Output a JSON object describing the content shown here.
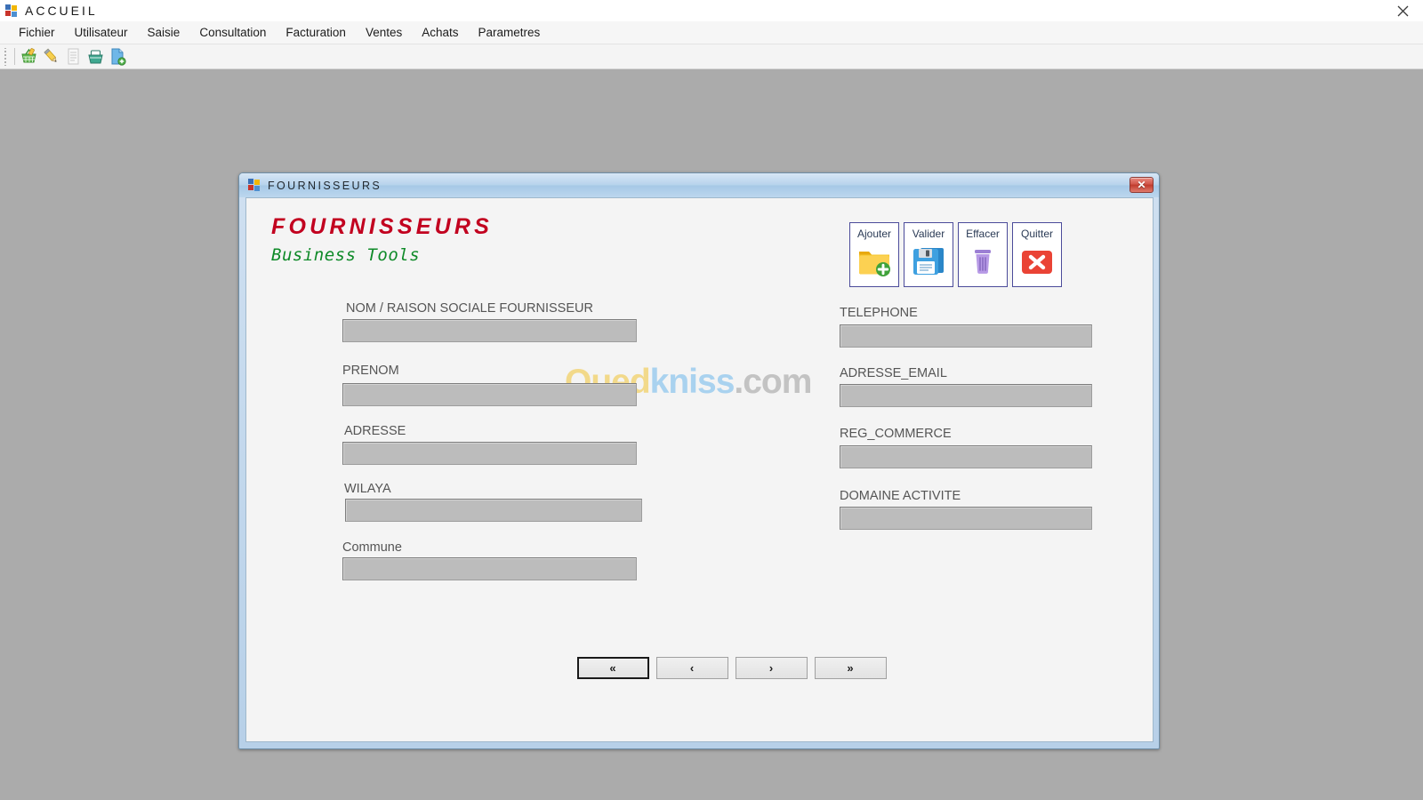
{
  "main_window": {
    "title": "ACCUEIL",
    "icon": "app-squares-icon",
    "close_label": "×"
  },
  "menubar": {
    "items": [
      {
        "label": "Fichier",
        "name": "fichier"
      },
      {
        "label": "Utilisateur",
        "name": "utilisateur"
      },
      {
        "label": "Saisie",
        "name": "saisie"
      },
      {
        "label": "Consultation",
        "name": "consultation"
      },
      {
        "label": "Facturation",
        "name": "facturation"
      },
      {
        "label": "Ventes",
        "name": "ventes"
      },
      {
        "label": "Achats",
        "name": "achats"
      },
      {
        "label": "Parametres",
        "name": "parametres"
      }
    ]
  },
  "toolbar": {
    "buttons": [
      {
        "icon": "basket-edit-icon",
        "enabled": true
      },
      {
        "icon": "pencil-icon",
        "enabled": true
      },
      {
        "icon": "document-list-icon",
        "enabled": false
      },
      {
        "icon": "basket-icon",
        "enabled": true
      },
      {
        "icon": "document-add-icon",
        "enabled": true
      }
    ]
  },
  "dialog": {
    "title": "FOURNISSEURS",
    "icon": "app-squares-icon",
    "close_label": "✕",
    "brand": {
      "title": "FOURNISSEURS",
      "subtitle": "Business Tools",
      "title_color": "#c2001f",
      "subtitle_color": "#0e8a28"
    },
    "watermark": {
      "part1": "Oued",
      "part2": "kniss",
      "part3": ".com",
      "color1": "#f2d98a",
      "color2": "#a9d2ef",
      "color3": "#c3c3c3"
    },
    "actions": [
      {
        "label": "Ajouter",
        "icon": "folder-add-icon",
        "name": "ajouter"
      },
      {
        "label": "Valider",
        "icon": "floppy-save-icon",
        "name": "valider"
      },
      {
        "label": "Effacer",
        "icon": "trash-icon",
        "name": "effacer"
      },
      {
        "label": "Quitter",
        "icon": "red-close-icon",
        "name": "quitter"
      }
    ],
    "fields_left": [
      {
        "label": "NOM / RAISON SOCIALE FOURNISSEUR",
        "value": "",
        "name": "nom-raison-sociale-fournisseur"
      },
      {
        "label": "PRENOM",
        "value": "",
        "name": "prenom"
      },
      {
        "label": "ADRESSE",
        "value": "",
        "name": "adresse"
      },
      {
        "label": "WILAYA",
        "value": "",
        "name": "wilaya"
      },
      {
        "label": "Commune",
        "value": "",
        "name": "commune"
      }
    ],
    "fields_right": [
      {
        "label": "TELEPHONE",
        "value": "",
        "name": "telephone"
      },
      {
        "label": "ADRESSE_EMAIL",
        "value": "",
        "name": "adresse-email"
      },
      {
        "label": "REG_COMMERCE",
        "value": "",
        "name": "reg-commerce"
      },
      {
        "label": "DOMAINE ACTIVITE",
        "value": "",
        "name": "domaine-activite"
      }
    ],
    "navigation": [
      {
        "label": "«",
        "name": "first",
        "focused": true
      },
      {
        "label": "‹",
        "name": "previous",
        "focused": false
      },
      {
        "label": "›",
        "name": "next",
        "focused": false
      },
      {
        "label": "»",
        "name": "last",
        "focused": false
      }
    ]
  }
}
